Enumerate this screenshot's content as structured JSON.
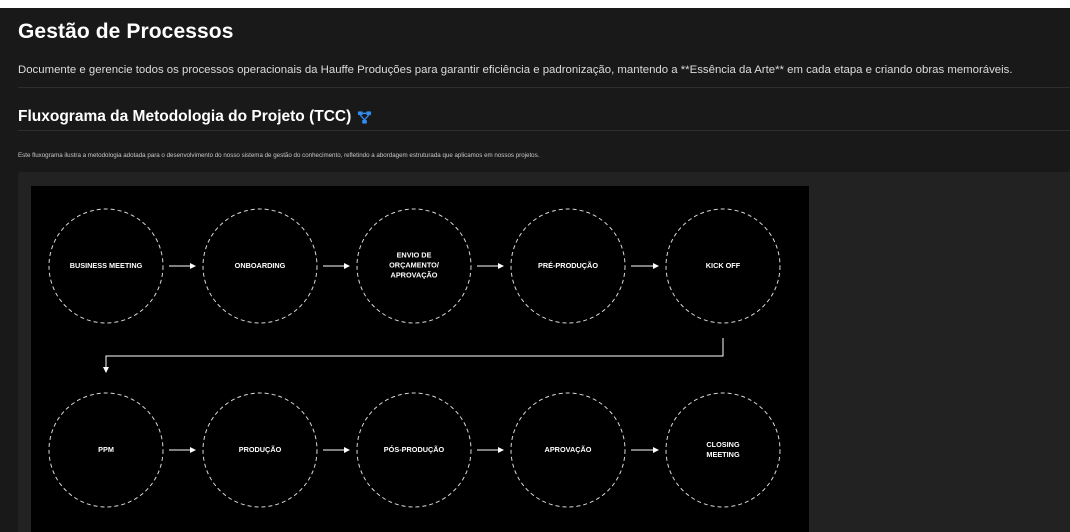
{
  "header": {
    "title": "Gestão de Processos",
    "description": "Documente e gerencie todos os processos operacionais da Hauffe Produções para garantir eficiência e padronização, mantendo a **Essência da Arte** em cada etapa e criando obras memoráveis."
  },
  "section": {
    "title": "Fluxograma da Metodologia do Projeto (TCC)",
    "icon": "flowchart-icon",
    "icon_color": "#2f8cf0",
    "caption": "Este fluxograma ilustra a metodologia adotada para o desenvolvimento do nosso sistema de gestão do conhecimento, refletindo a abordagem estruturada que aplicamos em nossos projetos."
  },
  "flowchart": {
    "row1": [
      "BUSINESS MEETING",
      "ONBOARDING",
      "ENVIO DE\nORÇAMENTO/\nAPROVAÇÃO",
      "PRÉ-PRODUÇÃO",
      "KICK OFF"
    ],
    "row2": [
      "PPM",
      "PRODUÇÃO",
      "PÓS-PRODUÇÃO",
      "APROVAÇÃO",
      "CLOSING\nMEETING"
    ]
  }
}
